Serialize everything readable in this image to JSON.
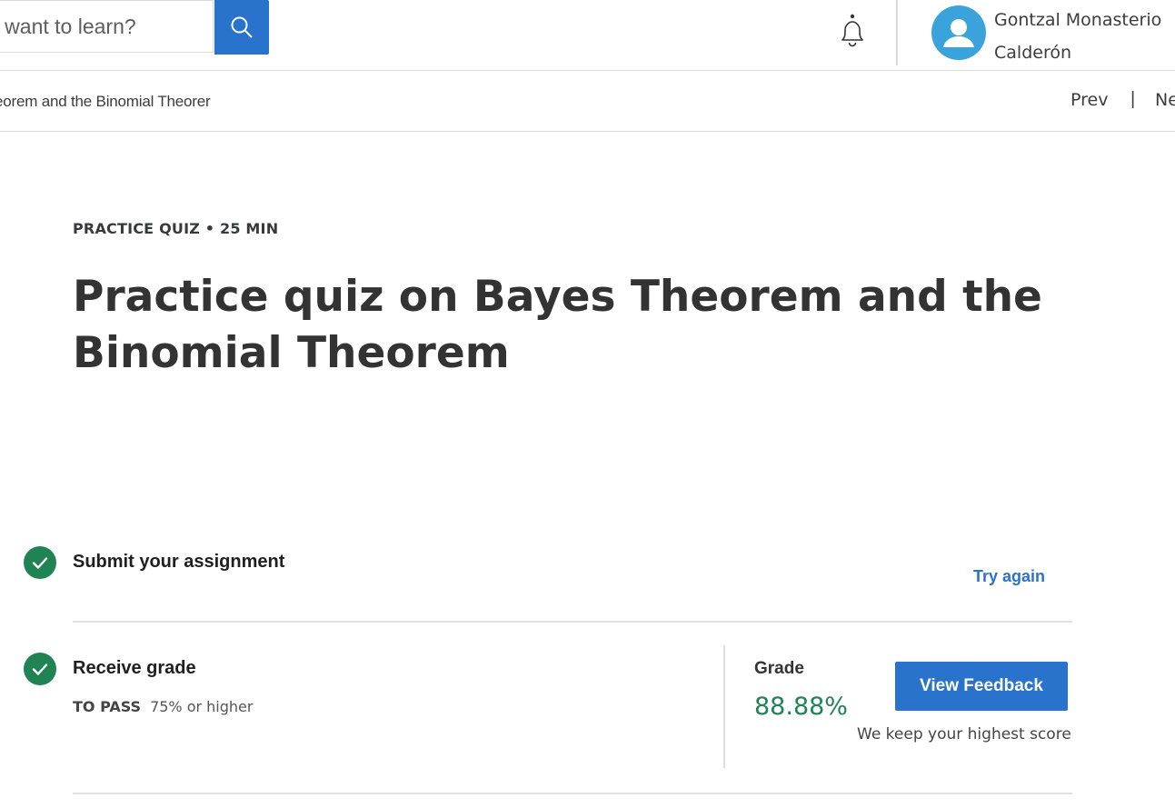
{
  "header": {
    "search_placeholder": "u want to learn?",
    "search_icon": "search-icon",
    "notification_icon": "bell-icon",
    "avatar_icon": "user-avatar-icon",
    "user_name": "Gontzal Monasterio Calderón"
  },
  "nav": {
    "breadcrumb": "eorem and the Binomial Theorer",
    "prev_label": "Prev",
    "separator": "|",
    "next_label": "Ne"
  },
  "main": {
    "meta": "PRACTICE QUIZ • 25 MIN",
    "title": "Practice quiz on Bayes Theorem and the Binomial Theorem"
  },
  "steps": [
    {
      "label": "Submit your assignment",
      "status_icon": "check-circle-icon",
      "action": "Try again"
    },
    {
      "label": "Receive grade",
      "status_icon": "check-circle-icon",
      "to_pass_key": "TO PASS",
      "to_pass_value": "75% or higher"
    }
  ],
  "grade": {
    "label": "Grade",
    "value": "88.88%",
    "button_label": "View Feedback",
    "note": "We keep your highest score"
  },
  "colors": {
    "accent": "#2a73cc",
    "success": "#1f8354",
    "avatar": "#3aa3db"
  }
}
